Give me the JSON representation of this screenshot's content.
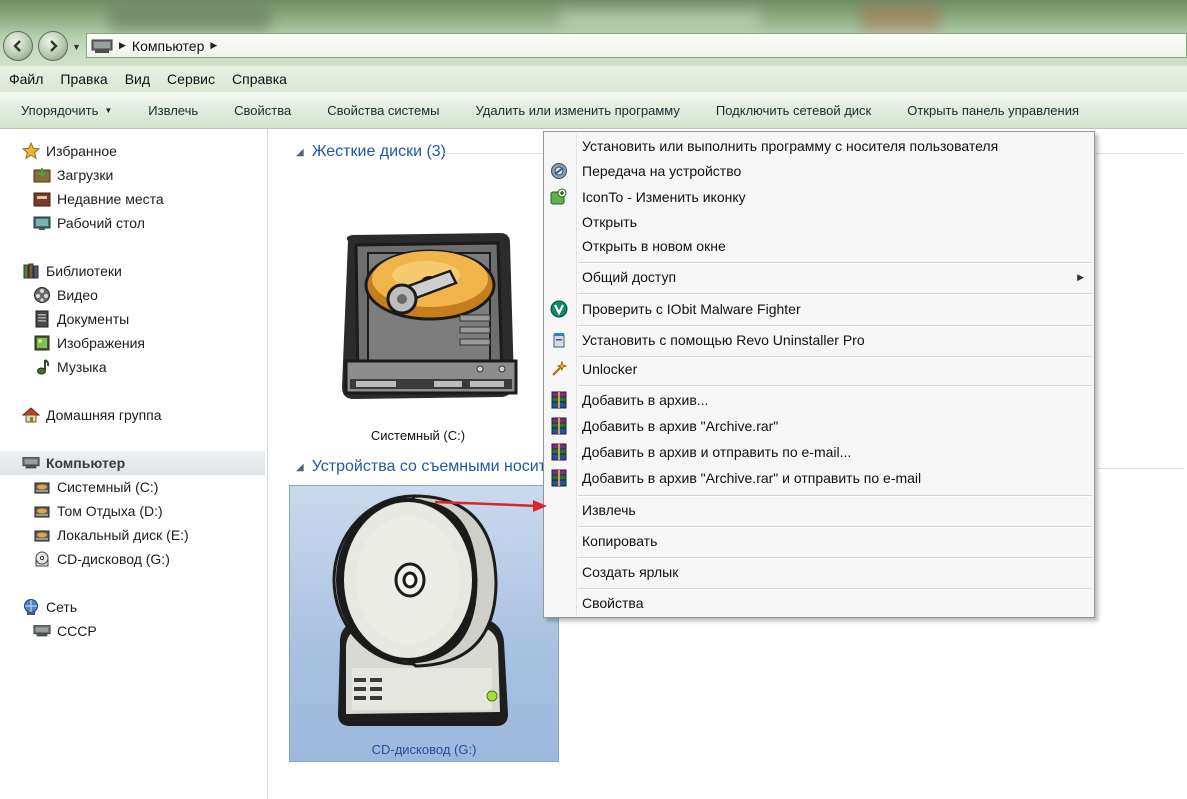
{
  "address": {
    "location": "Компьютер"
  },
  "menu": {
    "items": [
      "Файл",
      "Правка",
      "Вид",
      "Сервис",
      "Справка"
    ]
  },
  "toolbar": {
    "organize": "Упорядочить",
    "eject": "Извлечь",
    "properties": "Свойства",
    "system_properties": "Свойства системы",
    "uninstall": "Удалить или изменить программу",
    "map_drive": "Подключить сетевой диск",
    "control_panel": "Открыть панель управления"
  },
  "sidebar": {
    "favorites": {
      "title": "Избранное",
      "items": [
        "Загрузки",
        "Недавние места",
        "Рабочий стол"
      ]
    },
    "libraries": {
      "title": "Библиотеки",
      "items": [
        "Видео",
        "Документы",
        "Изображения",
        "Музыка"
      ]
    },
    "homegroup": "Домашняя группа",
    "computer": {
      "title": "Компьютер",
      "items": [
        "Системный (C:)",
        "Том Отдыха (D:)",
        "Локальный диск (E:)",
        "CD-дисковод (G:)"
      ]
    },
    "network": {
      "title": "Сеть",
      "items": [
        "СССР"
      ]
    }
  },
  "content": {
    "hard_drives_header": "Жесткие диски (3)",
    "removable_header": "Устройства со съемными носит",
    "drive_c_label": "Системный (C:)",
    "drive_g_label": "CD-дисковод (G:)"
  },
  "context_menu": {
    "items": [
      "Установить или выполнить программу с носителя пользователя",
      "Передача на устройство",
      "IconTo - Изменить иконку",
      "Открыть",
      "Открыть в новом окне",
      "Общий доступ",
      "Проверить с IObit Malware Fighter",
      "Установить с помощью Revo Uninstaller Pro",
      "Unlocker",
      "Добавить в архив...",
      "Добавить в архив \"Archive.rar\"",
      "Добавить в архив и отправить по e-mail...",
      "Добавить в архив \"Archive.rar\" и отправить по e-mail",
      "Извлечь",
      "Копировать",
      "Создать ярлык",
      "Свойства"
    ]
  },
  "colors": {
    "link_blue": "#1e5aa8",
    "selection_blue": "#a8c1e0",
    "annotation_red": "#d9282b"
  }
}
